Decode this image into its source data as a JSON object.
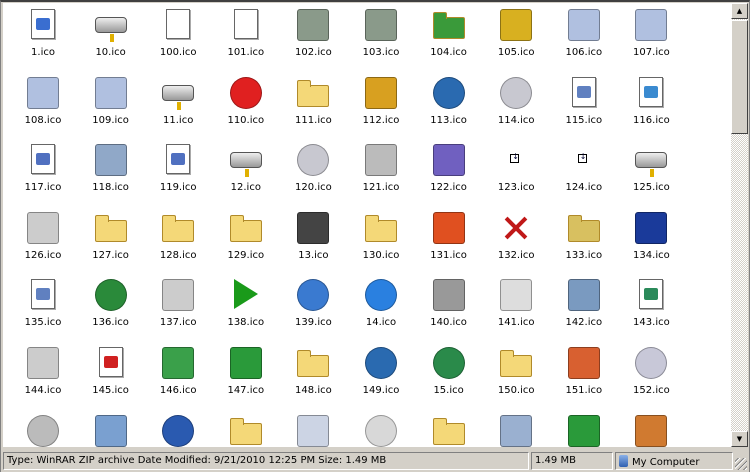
{
  "items": [
    {
      "label": "1.ico",
      "icon": "app-window-doc-icon",
      "color": "#3a6ed0"
    },
    {
      "label": "10.ico",
      "icon": "network-drive-icon",
      "color": "#999"
    },
    {
      "label": "100.ico",
      "icon": "hand-cursor-doc-icon",
      "color": "#fff"
    },
    {
      "label": "101.ico",
      "icon": "arrow-cursor-doc-icon",
      "color": "#fff"
    },
    {
      "label": "102.ico",
      "icon": "recycle-bin-empty-icon",
      "color": "#8a9a8a"
    },
    {
      "label": "103.ico",
      "icon": "recycle-bin-full-icon",
      "color": "#8a9a8a"
    },
    {
      "label": "104.ico",
      "icon": "globe-folder-icon",
      "color": "#3a9a3a"
    },
    {
      "label": "105.ico",
      "icon": "keys-icon",
      "color": "#d8b020"
    },
    {
      "label": "106.ico",
      "icon": "fax-icon",
      "color": "#b0c0e0"
    },
    {
      "label": "107.ico",
      "icon": "fax-default-icon",
      "color": "#b0c0e0"
    },
    {
      "label": "108.ico",
      "icon": "network-fax-default-icon",
      "color": "#b0c0e0"
    },
    {
      "label": "109.ico",
      "icon": "network-fax-icon",
      "color": "#b0c0e0"
    },
    {
      "label": "11.ico",
      "icon": "disconnected-drive-icon",
      "color": "#999"
    },
    {
      "label": "110.ico",
      "icon": "no-entry-round-icon",
      "color": "#e02020"
    },
    {
      "label": "111.ico",
      "icon": "folder-checked-icon",
      "color": "#f4d878"
    },
    {
      "label": "112.ico",
      "icon": "user-person-icon",
      "color": "#d8a020"
    },
    {
      "label": "113.ico",
      "icon": "power-round-icon",
      "color": "#2a6ab0"
    },
    {
      "label": "114.ico",
      "icon": "dvd-round-icon",
      "color": "#c8c8d0"
    },
    {
      "label": "115.ico",
      "icon": "documents-doc-icon",
      "color": "#6080c0"
    },
    {
      "label": "116.ico",
      "icon": "video-doc-icon",
      "color": "#3a8ad0"
    },
    {
      "label": "117.ico",
      "icon": "music-doc-icon",
      "color": "#5070c0"
    },
    {
      "label": "118.ico",
      "icon": "photos-icon",
      "color": "#90a8c8"
    },
    {
      "label": "119.ico",
      "icon": "media-doc-icon",
      "color": "#5070c0"
    },
    {
      "label": "12.ico",
      "icon": "cd-drive-icon",
      "color": "#999"
    },
    {
      "label": "120.ico",
      "icon": "music-cd-round-icon",
      "color": "#c8c8d0"
    },
    {
      "label": "121.ico",
      "icon": "mouse-icon",
      "color": "#bbb"
    },
    {
      "label": "122.ico",
      "icon": "scanner-icon",
      "color": "#7060c0"
    },
    {
      "label": "123.ico",
      "icon": "tiny-arrow-icon",
      "color": "#fff"
    },
    {
      "label": "124.ico",
      "icon": "tiny-arrow-icon",
      "color": "#fff"
    },
    {
      "label": "125.ico",
      "icon": "hard-drive-icon",
      "color": "#aaa"
    },
    {
      "label": "126.ico",
      "icon": "printer-error-icon",
      "color": "#ccc"
    },
    {
      "label": "127.ico",
      "icon": "folder-open-icon",
      "color": "#f4d878"
    },
    {
      "label": "128.ico",
      "icon": "folder-pictures-icon",
      "color": "#f4d878"
    },
    {
      "label": "129.ico",
      "icon": "folder-music-icon",
      "color": "#f4d878"
    },
    {
      "label": "13.ico",
      "icon": "chip-icon",
      "color": "#444"
    },
    {
      "label": "130.ico",
      "icon": "folder-documents-icon",
      "color": "#f4d878"
    },
    {
      "label": "131.ico",
      "icon": "windows-logo-icon",
      "color": "#e05020"
    },
    {
      "label": "132.ico",
      "icon": "x-icon",
      "color": "#c01818"
    },
    {
      "label": "133.ico",
      "icon": "folder-move-icon",
      "color": "#d8c060"
    },
    {
      "label": "134.ico",
      "icon": "monitor-projector-icon",
      "color": "#1a3a9a"
    },
    {
      "label": "135.ico",
      "icon": "documents-doc-icon",
      "color": "#6080c0"
    },
    {
      "label": "136.ico",
      "icon": "globe-upload-round-icon",
      "color": "#2a8a3a"
    },
    {
      "label": "137.ico",
      "icon": "printer-icon",
      "color": "#ccc"
    },
    {
      "label": "138.ico",
      "icon": "play-icon",
      "color": "#1a9a1a"
    },
    {
      "label": "139.ico",
      "icon": "globe-network-round-icon",
      "color": "#3a7ad0"
    },
    {
      "label": "14.ico",
      "icon": "internet-explorer-round-icon",
      "color": "#2a80e0"
    },
    {
      "label": "140.ico",
      "icon": "camera-icon",
      "color": "#999"
    },
    {
      "label": "141.ico",
      "icon": "presentation-icon",
      "color": "#ddd"
    },
    {
      "label": "142.ico",
      "icon": "monitor-pen-icon",
      "color": "#7a9ac0"
    },
    {
      "label": "143.ico",
      "icon": "globe-doc-icon",
      "color": "#2a8a5a"
    },
    {
      "label": "144.ico",
      "icon": "printer-picture-icon",
      "color": "#ccc"
    },
    {
      "label": "145.ico",
      "icon": "checkmark-doc-icon",
      "color": "#d02020"
    },
    {
      "label": "146.ico",
      "icon": "recycle-green-icon",
      "color": "#3aa04a"
    },
    {
      "label": "147.ico",
      "icon": "green-arrow-icon",
      "color": "#2a9a3a"
    },
    {
      "label": "148.ico",
      "icon": "folder-arrow-icon",
      "color": "#f4d878"
    },
    {
      "label": "149.ico",
      "icon": "globe-search-round-icon",
      "color": "#2a6ab0"
    },
    {
      "label": "15.ico",
      "icon": "globe-mouse-round-icon",
      "color": "#2a8a4a"
    },
    {
      "label": "150.ico",
      "icon": "network-folder-icon",
      "color": "#f4d878"
    },
    {
      "label": "151.ico",
      "icon": "home-network-icon",
      "color": "#d86030"
    },
    {
      "label": "152.ico",
      "icon": "clock-round-icon",
      "color": "#c8c8d8"
    },
    {
      "label": "",
      "icon": "cd-user-round-icon",
      "color": "#bbb"
    },
    {
      "label": "",
      "icon": "network-globe-icon",
      "color": "#7aa0d0"
    },
    {
      "label": "",
      "icon": "help-round-icon",
      "color": "#2a5ab0"
    },
    {
      "label": "",
      "icon": "folder-green-arrow-icon",
      "color": "#f4d878"
    },
    {
      "label": "",
      "icon": "mail-icon",
      "color": "#ccd4e4"
    },
    {
      "label": "",
      "icon": "clock-green-round-icon",
      "color": "#d8d8d8"
    },
    {
      "label": "",
      "icon": "folder-open-icon",
      "color": "#f4d878"
    },
    {
      "label": "",
      "icon": "network-computer-icon",
      "color": "#9ab0d0"
    },
    {
      "label": "",
      "icon": "accessibility-icon",
      "color": "#2a9a3a"
    },
    {
      "label": "",
      "icon": "users-icon",
      "color": "#d07a30"
    }
  ],
  "status": {
    "details": "Type: WinRAR ZIP archive Date Modified: 9/21/2010 12:25 PM Size: 1.49 MB",
    "size": "1.49 MB",
    "zone": "My Computer"
  },
  "scrollbar": {
    "position_fraction": 0
  }
}
